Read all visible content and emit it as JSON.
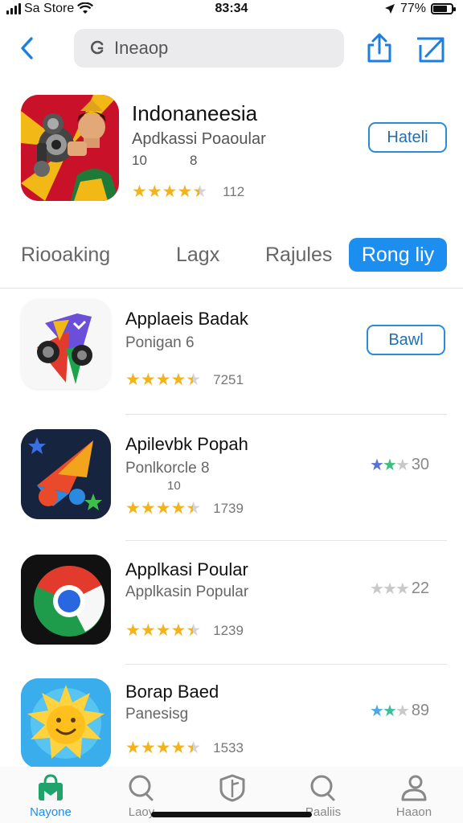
{
  "status_bar": {
    "carrier": "Sa Store",
    "time": "83:34",
    "battery": "77%"
  },
  "search": {
    "value": "Ineaop",
    "placeholder": "Ineaop"
  },
  "hero": {
    "title": "Indonaneesia",
    "subtitle": "Apdkassi Poaoular",
    "meta_a": "10",
    "meta_b": "8",
    "rating": 4.5,
    "rating_count": "112",
    "button": "Hateli"
  },
  "tabs": [
    {
      "label": "Riooaking",
      "active": false
    },
    {
      "label": "Lagx",
      "active": false
    },
    {
      "label": "Rajules",
      "active": false
    },
    {
      "label": "Rong liy",
      "active": true
    }
  ],
  "apps": [
    {
      "title": "Applaeis Badak",
      "subtitle": "Ponigan 6",
      "extra": "",
      "rating": 4.5,
      "rating_count": "7251",
      "button": "Bawl",
      "side_rating": "",
      "icon": "camera-pin-icon"
    },
    {
      "title": "Apilevbk Popah",
      "subtitle": "Ponlkorcle 8",
      "extra": "10",
      "rating": 4.5,
      "rating_count": "1739",
      "button": "",
      "side_rating": "30",
      "icon": "music-star-icon"
    },
    {
      "title": "Applkasi Poular",
      "subtitle": "Applkasin Popular",
      "extra": "",
      "rating": 4.5,
      "rating_count": "1239",
      "button": "",
      "side_rating": "22",
      "icon": "chrome-icon"
    },
    {
      "title": "Borap Baed",
      "subtitle": "Panesisg",
      "extra": "",
      "rating": 4.5,
      "rating_count": "1533",
      "button": "",
      "side_rating": "89",
      "icon": "sun-face-icon"
    }
  ],
  "tab_bar": [
    {
      "label": "Nayone",
      "icon": "store-bag-icon",
      "active": true
    },
    {
      "label": "Laoy",
      "icon": "search-icon",
      "active": false
    },
    {
      "label": "",
      "icon": "shield-icon",
      "active": false
    },
    {
      "label": "Paaliis",
      "icon": "search-alt-icon",
      "active": false
    },
    {
      "label": "Haaon",
      "icon": "person-icon",
      "active": false
    }
  ],
  "colors": {
    "accent": "#1c8ef0",
    "star": "#f3b31c",
    "outline_button": "#2a8bd6"
  }
}
